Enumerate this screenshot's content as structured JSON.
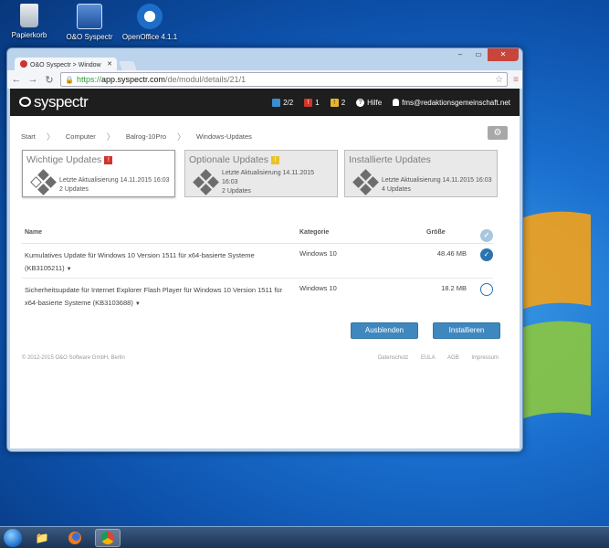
{
  "desktop": {
    "icons": [
      {
        "label": "Papierkorb"
      },
      {
        "label": "O&O Syspectr"
      },
      {
        "label": "OpenOffice 4.1.1"
      }
    ]
  },
  "browser": {
    "tab_title": "O&O Syspectr > Window",
    "url_scheme": "https://",
    "url_host": "app.syspectr.com",
    "url_path": "/de/modul/details/21/1",
    "win_min": "–",
    "win_max": "▭",
    "win_close": "✕"
  },
  "app": {
    "logo": "syspectr",
    "badges": {
      "devices": "2/2",
      "errors": "1",
      "warnings": "2",
      "error_glyph": "!",
      "warning_glyph": "!"
    },
    "help": "Hilfe",
    "user": "fms@redaktionsgemeinschaft.net"
  },
  "breadcrumb": [
    "Start",
    "Computer",
    "Balrog-10Pro",
    "Windows-Updates"
  ],
  "cards": [
    {
      "title": "Wichtige Updates",
      "alert": "!",
      "line1": "Letzte Aktualisierung 14.11.2015 16:03",
      "line2": "2 Updates"
    },
    {
      "title": "Optionale Updates",
      "alert": "!",
      "line1": "Letzte Aktualisierung 14.11.2015",
      "line1b": "16:03",
      "line2": "2 Updates"
    },
    {
      "title": "Installierte Updates",
      "line1": "Letzte Aktualisierung 14.11.2015 16:03",
      "line2": "4 Updates"
    }
  ],
  "table": {
    "headers": {
      "name": "Name",
      "category": "Kategorie",
      "size": "Größe"
    },
    "rows": [
      {
        "name": "Kumulatives Update für Windows 10 Version 1511 für x64-basierte Systeme (KB3105211)",
        "category": "Windows 10",
        "size": "48.46 MB",
        "selected": true
      },
      {
        "name": "Sicherheitsupdate für Internet Explorer Flash Player für Windows 10 Version 1511 für x64-basierte Systeme (KB3103688)",
        "category": "Windows 10",
        "size": "18.2 MB",
        "selected": false
      }
    ]
  },
  "actions": {
    "hide": "Ausblenden",
    "install": "Installieren"
  },
  "footer": {
    "copyright": "© 2012-2015 O&O Software GmbH, Berlin",
    "links": [
      "Datenschutz",
      "EULA",
      "AGB",
      "Impressum"
    ]
  },
  "colors": {
    "accent": "#3f88bf",
    "topbar": "#1e1e1e",
    "error": "#d0352b",
    "warning": "#e8b42b"
  }
}
